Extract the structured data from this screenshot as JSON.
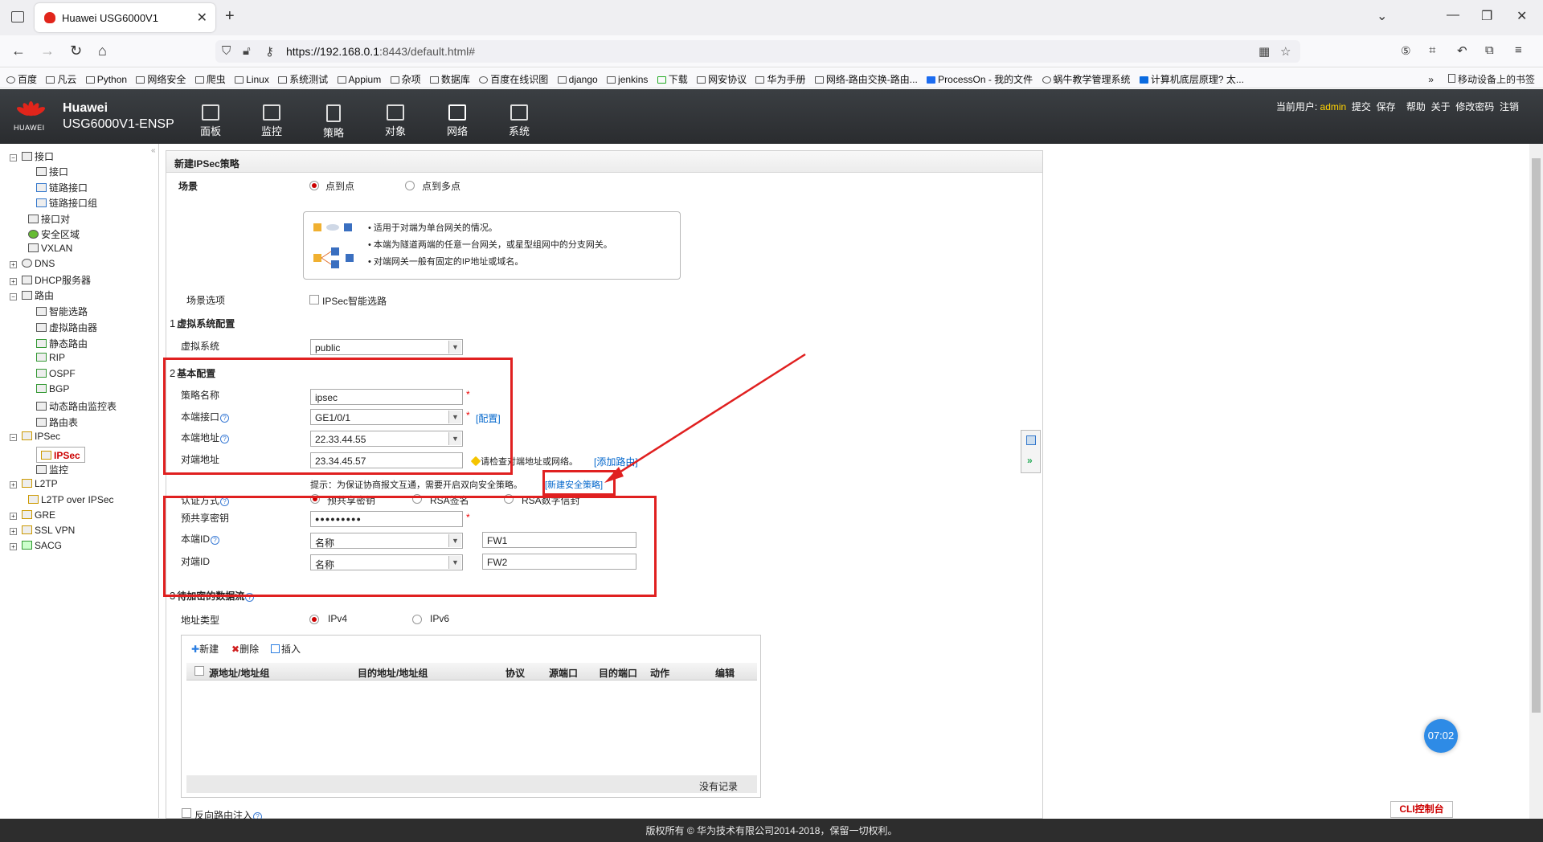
{
  "browser": {
    "tab_title": "Huawei USG6000V1",
    "url_host": "https://192.168.0.1",
    "url_rest": ":8443/default.html#",
    "bookmarks": [
      "百度",
      "凡云",
      "Python",
      "网络安全",
      "爬虫",
      "Linux",
      "系统测试",
      "Appium",
      "杂项",
      "数据库",
      "百度在线识图",
      "django",
      "jenkins",
      "下载",
      "网安协议",
      "华为手册",
      "网络-路由交换-路由...",
      "ProcessOn - 我的文件",
      "蜗牛教学管理系统",
      "计算机底层原理? 太..."
    ],
    "bookmarks_more": "»",
    "mobile_bookmarks": "移动设备上的书签"
  },
  "app": {
    "logo_text": "HUAWEI",
    "brand_line1": "Huawei",
    "brand_line2": "USG6000V1-ENSP",
    "nav": [
      "面板",
      "监控",
      "策略",
      "对象",
      "网络",
      "系统"
    ],
    "user_label": "当前用户:",
    "user_name": "admin",
    "user_actions": [
      "提交",
      "保存",
      "帮助",
      "关于",
      "修改密码",
      "注销"
    ]
  },
  "sidebar": {
    "items": [
      "接口",
      "接口",
      "链路接口",
      "链路接口组",
      "接口对",
      "安全区域",
      "VXLAN",
      "DNS",
      "DHCP服务器",
      "路由",
      "智能选路",
      "虚拟路由器",
      "静态路由",
      "RIP",
      "OSPF",
      "BGP",
      "动态路由监控表",
      "路由表",
      "IPSec",
      "IPSec",
      "监控",
      "L2TP",
      "L2TP over IPSec",
      "GRE",
      "SSL VPN",
      "SACG"
    ],
    "collapse": "«"
  },
  "form": {
    "panel_title": "新建IPSec策略",
    "scene_label": "场景",
    "scene_opt1": "点到点",
    "scene_opt2": "点到多点",
    "info_lines": [
      "适用于对端为单台网关的情况。",
      "本端为隧道两端的任意一台网关，或星型组网中的分支网关。",
      "对端网关一般有固定的IP地址或域名。"
    ],
    "scene_option_label": "场景选项",
    "smart_route": "IPSec智能选路",
    "sec1_num": "1",
    "sec1": "虚拟系统配置",
    "vsys_label": "虚拟系统",
    "vsys_value": "public",
    "sec2_num": "2",
    "sec2": "基本配置",
    "policy_name_label": "策略名称",
    "policy_name": "ipsec",
    "local_if_label": "本端接口",
    "local_if": "GE1/0/1",
    "config_link": "[配置]",
    "local_addr_label": "本端地址",
    "local_addr": "22.33.44.55",
    "peer_addr_label": "对端地址",
    "peer_addr": "23.34.45.57",
    "peer_hint": "请检查对端地址或网络。",
    "add_route": "[添加路由]",
    "tip": "提示：为保证协商报文互通，需要开启双向安全策略。",
    "new_policy_link": "[新建安全策略]",
    "auth_label": "认证方式",
    "auth_opt1": "预共享密钥",
    "auth_opt2": "RSA签名",
    "auth_opt3": "RSA数字信封",
    "psk_label": "预共享密钥",
    "psk_value": "●●●●●●●●●",
    "local_id_label": "本端ID",
    "local_id_type": "名称",
    "local_id": "FW1",
    "peer_id_label": "对端ID",
    "peer_id_type": "名称",
    "peer_id": "FW2",
    "sec3_num": "3",
    "sec3": "待加密的数据流",
    "addr_type_label": "地址类型",
    "ipv4": "IPv4",
    "ipv6": "IPv6",
    "btn_new": "新建",
    "btn_delete": "删除",
    "btn_insert": "插入",
    "columns": [
      "源地址/地址组",
      "目的地址/地址组",
      "协议",
      "源端口",
      "目的端口",
      "动作",
      "编辑"
    ],
    "no_records": "没有记录",
    "reverse_route": "反向路由注入"
  },
  "misc": {
    "clock": "07:02",
    "cli": "CLI控制台",
    "copyright": "版权所有 © 华为技术有限公司2014-2018，保留一切权利。"
  },
  "colors": {
    "accent_red": "#e02020",
    "header_dark": "#2f3236",
    "link_blue": "#0066cc"
  }
}
